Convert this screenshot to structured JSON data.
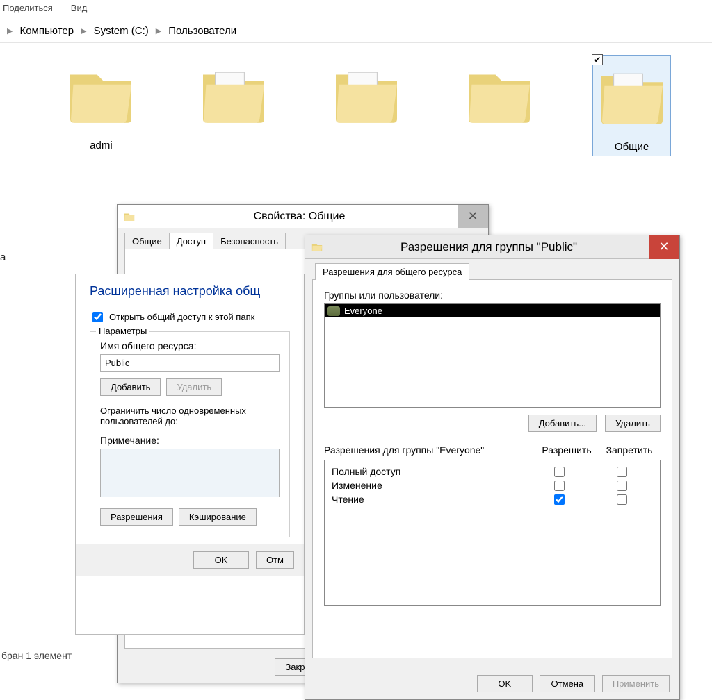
{
  "menu": {
    "share": "Поделиться",
    "view": "Вид"
  },
  "breadcrumb": {
    "a": "Компьютер",
    "b": "System (C:)",
    "c": "Пользователи"
  },
  "sidebar_fragment": "а",
  "statusbar": "бран 1 элемент",
  "folders": {
    "f1": "admi",
    "f5": "Общие"
  },
  "props": {
    "title": "Свойства: Общие",
    "tabs": {
      "general": "Общие",
      "access": "Доступ",
      "security": "Безопасность"
    },
    "close_btn": "Закрыть"
  },
  "adv": {
    "heading": "Расширенная настройка общ",
    "share_checkbox": "Открыть общий доступ к этой папк",
    "params_legend": "Параметры",
    "share_name_label": "Имя общего ресурса:",
    "share_name_value": "Public",
    "add": "Добавить",
    "delete": "Удалить",
    "limit_label1": "Ограничить число одновременных",
    "limit_label2": "пользователей до:",
    "note_label": "Примечание:",
    "permissions_btn": "Разрешения",
    "caching_btn": "Кэширование",
    "ok": "OK",
    "cancel": "Отм"
  },
  "perm": {
    "title": "Разрешения для группы \"Public\"",
    "tab": "Разрешения для общего ресурса",
    "groups_label": "Группы или пользователи:",
    "user_everyone": "Everyone",
    "add": "Добавить...",
    "delete": "Удалить",
    "perm_for_label": "Разрешения для группы \"Everyone\"",
    "allow": "Разрешить",
    "deny": "Запретить",
    "rows": {
      "full": "Полный доступ",
      "change": "Изменение",
      "read": "Чтение"
    },
    "ok": "OK",
    "cancel": "Отмена",
    "apply": "Применить"
  }
}
